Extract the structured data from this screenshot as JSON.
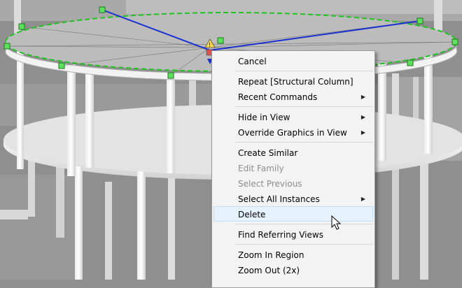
{
  "context_menu": {
    "groups": [
      {
        "items": [
          {
            "label": "Cancel",
            "enabled": true
          }
        ]
      },
      {
        "items": [
          {
            "label": "Repeat [Structural Column]",
            "enabled": true
          },
          {
            "label": "Recent Commands",
            "enabled": true,
            "submenu": true
          }
        ]
      },
      {
        "items": [
          {
            "label": "Hide in View",
            "enabled": true,
            "submenu": true
          },
          {
            "label": "Override Graphics in View",
            "enabled": true,
            "submenu": true
          }
        ]
      },
      {
        "items": [
          {
            "label": "Create Similar",
            "enabled": true
          },
          {
            "label": "Edit Family",
            "enabled": false
          },
          {
            "label": "Select Previous",
            "enabled": false
          },
          {
            "label": "Select All Instances",
            "enabled": true,
            "submenu": true
          },
          {
            "label": "Delete",
            "enabled": true,
            "hovered": true
          }
        ]
      },
      {
        "items": [
          {
            "label": "Find Referring Views",
            "enabled": true
          }
        ]
      },
      {
        "items": [
          {
            "label": "Zoom In Region",
            "enabled": true
          },
          {
            "label": "Zoom Out (2x)",
            "enabled": true
          }
        ]
      }
    ]
  },
  "viewport": {
    "background_color": "#8f8f8f",
    "selection_color": "#22c222",
    "sketch_line_color": "#1a2fd0",
    "warning_icon": "warning-triangle-icon"
  }
}
